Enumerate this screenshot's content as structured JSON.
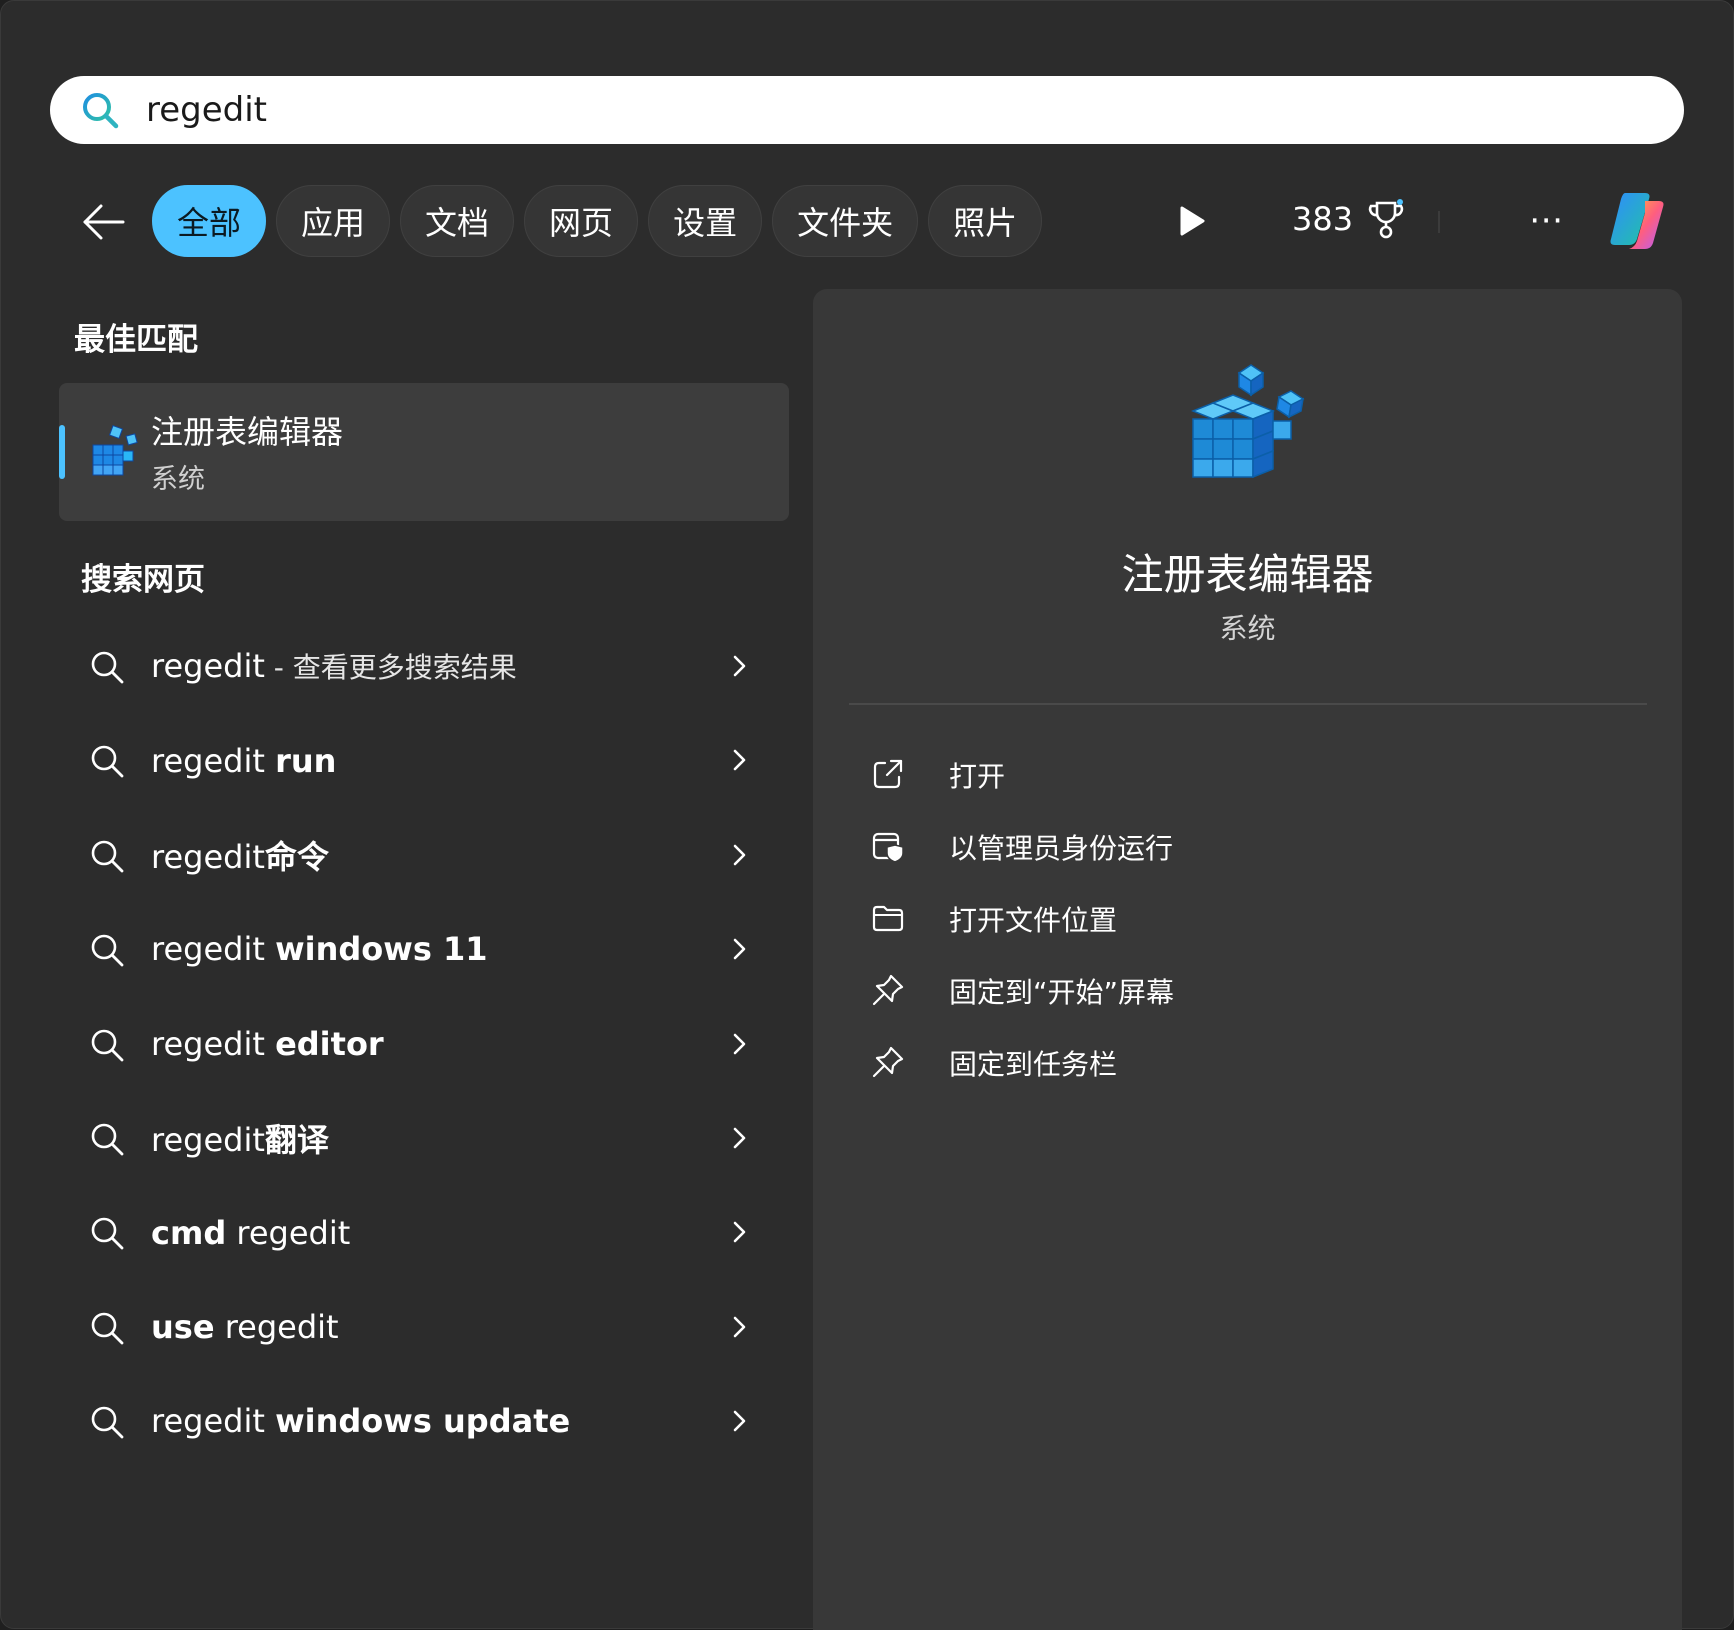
{
  "search": {
    "value": "regedit",
    "icon": "search-icon"
  },
  "filters": {
    "back_icon": "arrow-left-icon",
    "tabs": [
      {
        "label": "全部",
        "active": true
      },
      {
        "label": "应用",
        "active": false
      },
      {
        "label": "文档",
        "active": false
      },
      {
        "label": "网页",
        "active": false
      },
      {
        "label": "设置",
        "active": false
      },
      {
        "label": "文件夹",
        "active": false
      },
      {
        "label": "照片",
        "active": false
      }
    ],
    "play_icon": "play-icon",
    "rewards_points": "383",
    "trophy_icon": "trophy-icon",
    "more_icon": "more-icon",
    "copilot_icon": "copilot-icon"
  },
  "best_match": {
    "heading": "最佳匹配",
    "title": "注册表编辑器",
    "subtitle": "系统",
    "icon": "registry-editor-icon"
  },
  "web_search": {
    "heading": "搜索网页",
    "results": [
      {
        "prefix": "regedit",
        "bold": "",
        "suffix": " - 查看更多搜索结果"
      },
      {
        "prefix": "regedit ",
        "bold": "run",
        "suffix": ""
      },
      {
        "prefix": "regedit",
        "bold": "命令",
        "suffix": ""
      },
      {
        "prefix": "regedit ",
        "bold": "windows 11",
        "suffix": ""
      },
      {
        "prefix": "regedit ",
        "bold": "editor",
        "suffix": ""
      },
      {
        "prefix": "regedit",
        "bold": "翻译",
        "suffix": ""
      },
      {
        "prefix": "",
        "bold": "cmd",
        "suffix": " regedit"
      },
      {
        "prefix": "",
        "bold": "use",
        "suffix": " regedit"
      },
      {
        "prefix": "regedit ",
        "bold": "windows update",
        "suffix": ""
      }
    ]
  },
  "detail": {
    "title": "注册表编辑器",
    "subtitle": "系统",
    "actions": [
      {
        "label": "打开",
        "icon": "open-external-icon"
      },
      {
        "label": "以管理员身份运行",
        "icon": "run-as-admin-shield-icon"
      },
      {
        "label": "打开文件位置",
        "icon": "folder-icon"
      },
      {
        "label": "固定到“开始”屏幕",
        "icon": "pin-icon"
      },
      {
        "label": "固定到任务栏",
        "icon": "pin-icon"
      }
    ]
  },
  "colors": {
    "accent": "#4cc2ff",
    "panel_bg": "#2c2c2c",
    "detail_bg": "#383838",
    "selected_bg": "#3d3d3d"
  }
}
